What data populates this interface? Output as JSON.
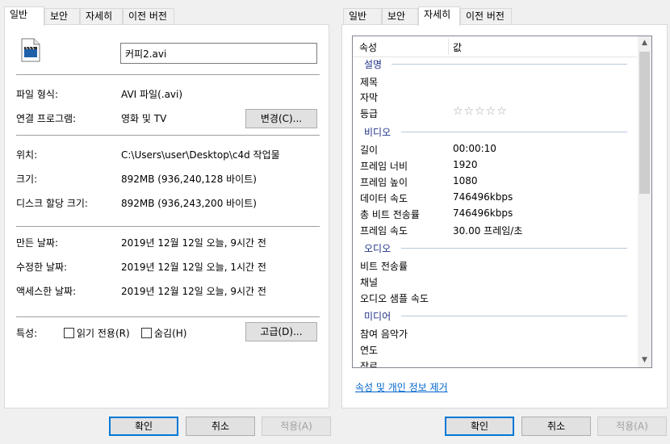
{
  "left": {
    "tabs": [
      "일반",
      "보안",
      "자세히",
      "이전 버전"
    ],
    "file_name": "커피2.avi",
    "rows": {
      "type_label": "파일 형식:",
      "type_value": "AVI 파일(.avi)",
      "app_label": "연결 프로그램:",
      "app_value": "영화 및 TV",
      "change_button": "변경(C)...",
      "location_label": "위치:",
      "location_value": "C:\\Users\\user\\Desktop\\c4d 작업물",
      "size_label": "크기:",
      "size_value": "892MB (936,240,128 바이트)",
      "disk_label": "디스크 할당 크기:",
      "disk_value": "892MB (936,243,200 바이트)",
      "created_label": "만든 날짜:",
      "created_value": "2019년 12월 12일 오늘, 9시간 전",
      "modified_label": "수정한 날짜:",
      "modified_value": "2019년 12월 12일 오늘, 1시간 전",
      "accessed_label": "액세스한 날짜:",
      "accessed_value": "2019년 12월 12일 오늘, 9시간 전",
      "attr_label": "특성:",
      "readonly_label": "읽기 전용(R)",
      "hidden_label": "숨김(H)",
      "advanced_button": "고급(D)..."
    },
    "buttons": {
      "ok": "확인",
      "cancel": "취소",
      "apply": "적용(A)"
    }
  },
  "right": {
    "tabs": [
      "일반",
      "보안",
      "자세히",
      "이전 버전"
    ],
    "header": {
      "prop": "속성",
      "value": "값"
    },
    "groups": {
      "desc": "설명",
      "video": "비디오",
      "audio": "오디오",
      "media": "미디어"
    },
    "rows": {
      "title": "제목",
      "subtitle": "자막",
      "rating": "등급",
      "rating_stars": "☆☆☆☆☆",
      "length": "길이",
      "length_value": "00:00:10",
      "width": "프레임 너비",
      "width_value": "1920",
      "height": "프레임 높이",
      "height_value": "1080",
      "datarate": "데이터 속도",
      "datarate_value": "746496kbps",
      "bitrate": "총 비트 전송률",
      "bitrate_value": "746496kbps",
      "framerate": "프레임 속도",
      "framerate_value": "30.00 프레임/초",
      "a_bitrate": "비트 전송률",
      "channels": "채널",
      "samplerate": "오디오 샘플 속도",
      "artist": "참여 음악가",
      "year": "연도",
      "genre": "장르"
    },
    "remove_link": "속성 및 개인 정보 제거",
    "buttons": {
      "ok": "확인",
      "cancel": "취소",
      "apply": "적용(A)"
    }
  }
}
